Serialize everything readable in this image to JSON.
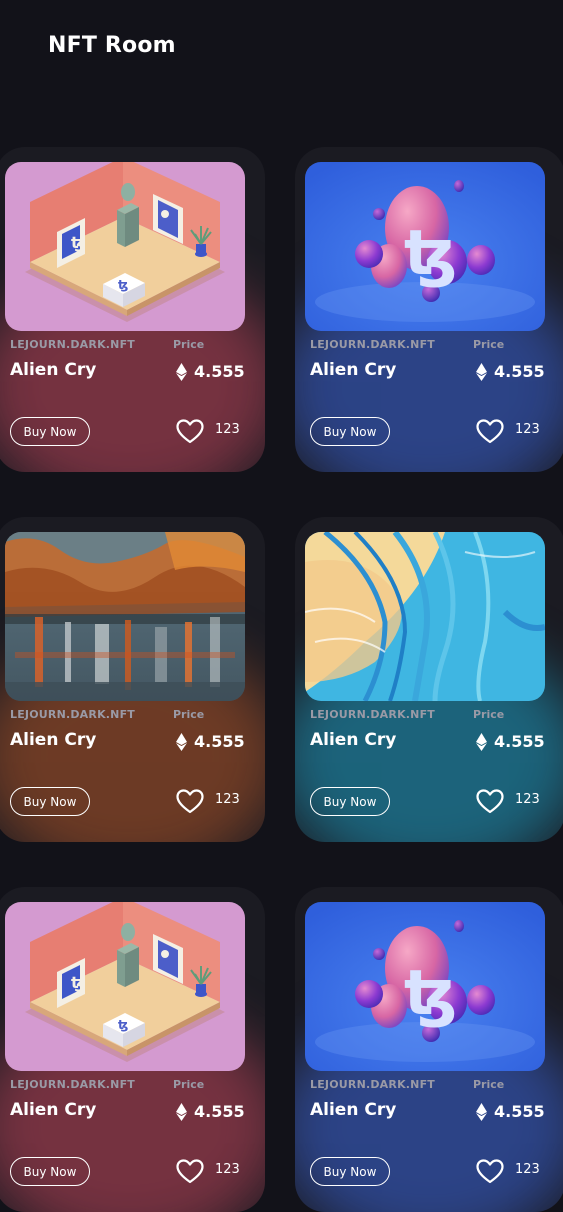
{
  "header": {
    "title": "NFT Room"
  },
  "cards": [
    {
      "creator": "LEJOURN.DARK.NFT",
      "price_label": "Price",
      "name": "Alien Cry",
      "price": "4.555",
      "buy_label": "Buy Now",
      "likes": "123",
      "art": "isometric-room",
      "glow_color": "#c0455a"
    },
    {
      "creator": "LEJOURN.DARK.NFT",
      "price_label": "Price",
      "name": "Alien Cry",
      "price": "4.555",
      "buy_label": "Buy Now",
      "likes": "123",
      "art": "tezos-spheres",
      "glow_color": "#3a64d8"
    },
    {
      "creator": "LEJOURN.DARK.NFT",
      "price_label": "Price",
      "name": "Alien Cry",
      "price": "4.555",
      "buy_label": "Buy Now",
      "likes": "123",
      "art": "abstract-autumn",
      "glow_color": "#b05528"
    },
    {
      "creator": "LEJOURN.DARK.NFT",
      "price_label": "Price",
      "name": "Alien Cry",
      "price": "4.555",
      "buy_label": "Buy Now",
      "likes": "123",
      "art": "fluid-wave",
      "glow_color": "#1d9fc4"
    },
    {
      "creator": "LEJOURN.DARK.NFT",
      "price_label": "Price",
      "name": "Alien Cry",
      "price": "4.555",
      "buy_label": "Buy Now",
      "likes": "123",
      "art": "isometric-room",
      "glow_color": "#c0455a"
    },
    {
      "creator": "LEJOURN.DARK.NFT",
      "price_label": "Price",
      "name": "Alien Cry",
      "price": "4.555",
      "buy_label": "Buy Now",
      "likes": "123",
      "art": "tezos-spheres",
      "glow_color": "#3a64d8"
    }
  ]
}
